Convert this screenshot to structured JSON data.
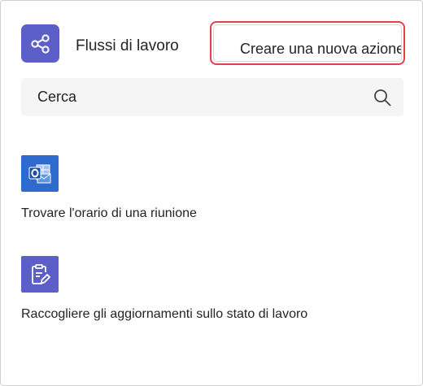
{
  "header": {
    "icon": "workflow-share-icon",
    "title": "Flussi di lavoro",
    "new_action_label": "Creare una nuova azione",
    "highlight_color": "#e0434c"
  },
  "search": {
    "placeholder": "Cerca",
    "icon": "search-icon"
  },
  "workflows": [
    {
      "label": "Trovare l'orario di una riunione",
      "icon": "outlook-calendar-icon",
      "color": "#2f6bce"
    },
    {
      "label": "Raccogliere gli aggiornamenti sullo stato di lavoro",
      "icon": "clipboard-edit-icon",
      "color": "#5b5fc7"
    }
  ],
  "colors": {
    "accent": "#5b5fc7"
  }
}
